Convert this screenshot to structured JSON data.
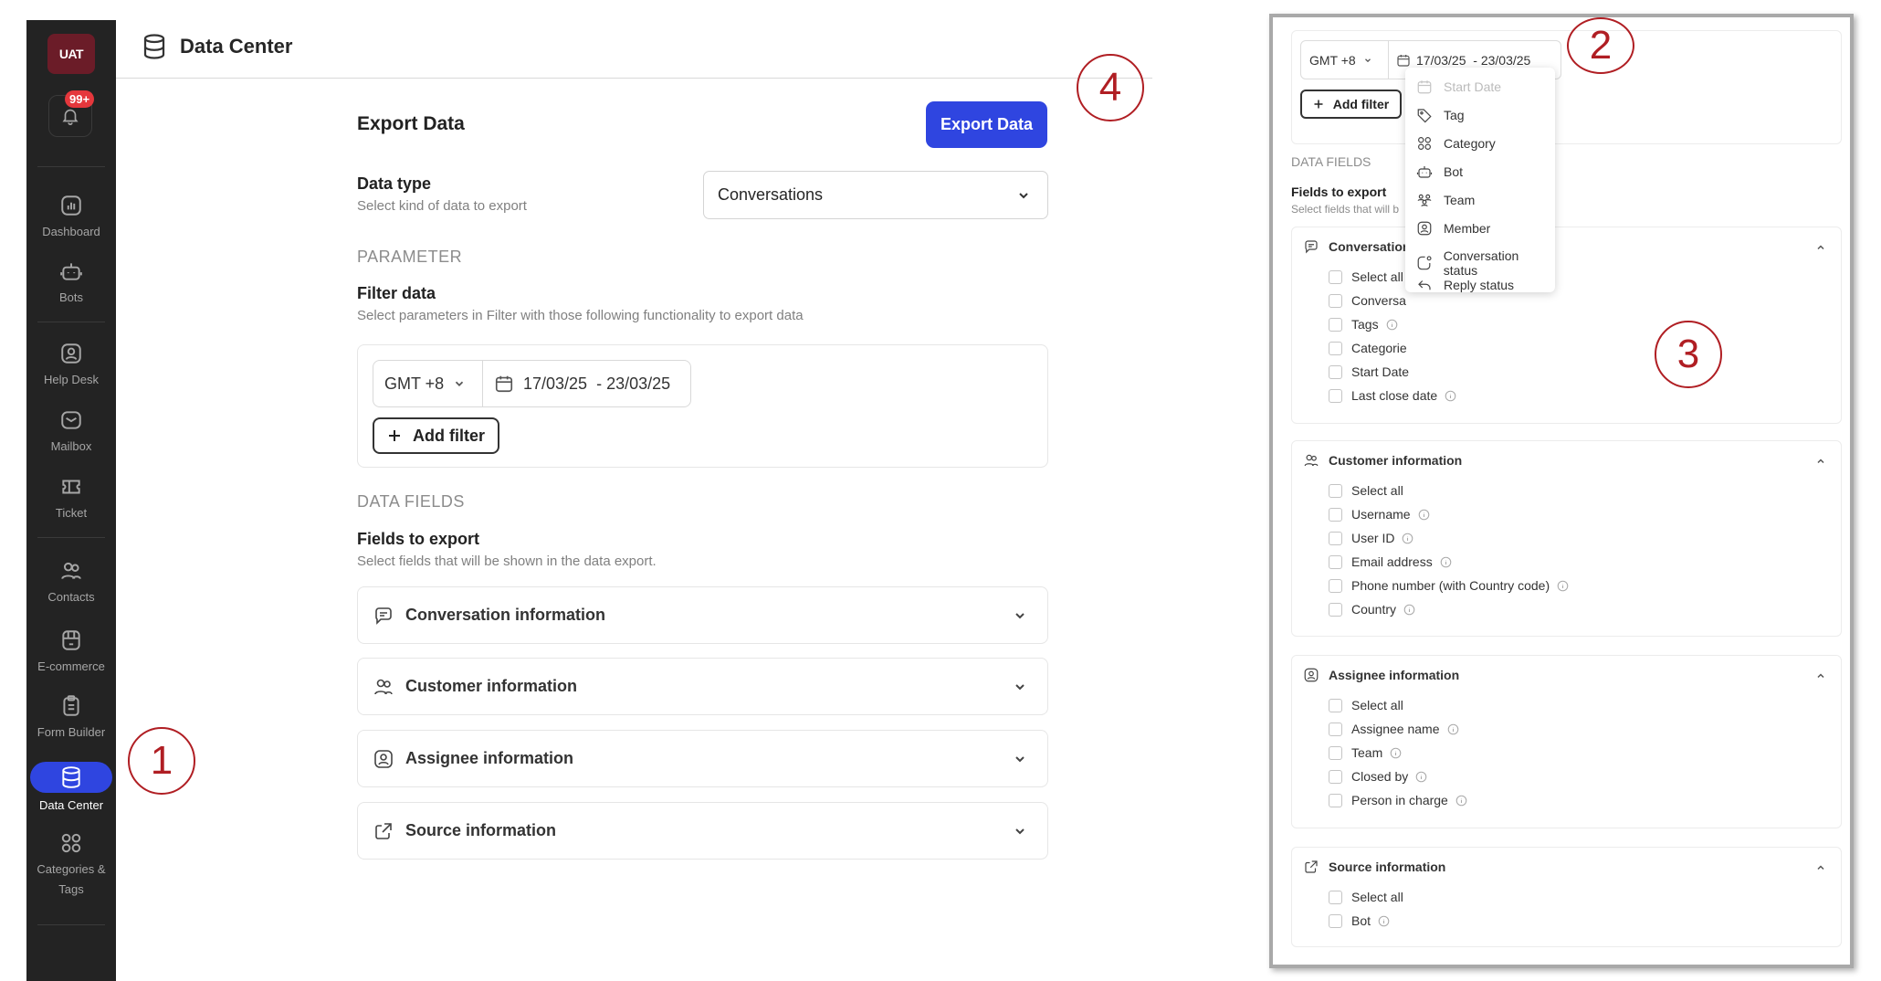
{
  "sidebar": {
    "logo": "UAT",
    "notification_badge": "99+",
    "items": [
      {
        "label": "Dashboard",
        "icon": "dashboard-icon"
      },
      {
        "label": "Bots",
        "icon": "bot-icon"
      },
      {
        "label": "Help Desk",
        "icon": "help-desk-icon"
      },
      {
        "label": "Mailbox",
        "icon": "mailbox-icon"
      },
      {
        "label": "Ticket",
        "icon": "ticket-icon"
      },
      {
        "label": "Contacts",
        "icon": "contacts-icon"
      },
      {
        "label": "E-commerce",
        "icon": "store-icon"
      },
      {
        "label": "Form Builder",
        "icon": "clipboard-icon"
      },
      {
        "label": "Data Center",
        "icon": "database-icon",
        "active": true
      },
      {
        "label": "Categories &",
        "label2": "Tags",
        "icon": "categories-icon"
      }
    ]
  },
  "header": {
    "title": "Data Center",
    "icon": "database-icon"
  },
  "export": {
    "title": "Export Data",
    "export_button": "Export Data",
    "data_type_label": "Data type",
    "data_type_help": "Select kind of data to export",
    "data_type_value": "Conversations",
    "parameter_section": "PARAMETER",
    "filter_label": "Filter data",
    "filter_help": "Select parameters in Filter with those following functionality to export data",
    "timezone": "GMT +8",
    "date_range": "17/03/25  - 23/03/25",
    "add_filter": "Add filter",
    "data_fields_section": "DATA FIELDS",
    "fields_label": "Fields to export",
    "fields_help": "Select fields that will be shown in the data export.",
    "accordions": [
      {
        "label": "Conversation information",
        "icon": "chat-icon"
      },
      {
        "label": "Customer information",
        "icon": "users-icon"
      },
      {
        "label": "Assignee information",
        "icon": "assignee-icon"
      },
      {
        "label": "Source information",
        "icon": "external-link-icon"
      }
    ]
  },
  "annotations": [
    "1",
    "2",
    "3",
    "4"
  ],
  "inset": {
    "timezone": "GMT +8",
    "date_range": "17/03/25  - 23/03/25",
    "add_filter": "Add filter",
    "data_fields_section": "DATA FIELDS",
    "fields_label": "Fields to export",
    "fields_help": "Select fields that will b",
    "filter_menu": [
      {
        "label": "Start Date",
        "icon": "calendar-icon",
        "disabled": true
      },
      {
        "label": "Tag",
        "icon": "tag-icon"
      },
      {
        "label": "Category",
        "icon": "category-icon"
      },
      {
        "label": "Bot",
        "icon": "bot-icon"
      },
      {
        "label": "Team",
        "icon": "team-icon"
      },
      {
        "label": "Member",
        "icon": "member-icon"
      },
      {
        "label": "Conversation status",
        "icon": "status-icon"
      },
      {
        "label": "Reply status",
        "icon": "reply-icon"
      }
    ],
    "groups": [
      {
        "title": "Conversation",
        "icon": "chat-icon",
        "rows": [
          {
            "label": "Select all",
            "info": false
          },
          {
            "label": "Conversa",
            "info": false
          },
          {
            "label": "Tags",
            "info": true
          },
          {
            "label": "Categorie",
            "info": false
          },
          {
            "label": "Start Date",
            "info": false
          },
          {
            "label": "Last close date",
            "info": true
          }
        ]
      },
      {
        "title": "Customer information",
        "icon": "users-icon",
        "rows": [
          {
            "label": "Select all",
            "info": false
          },
          {
            "label": "Username",
            "info": true
          },
          {
            "label": "User ID",
            "info": true
          },
          {
            "label": "Email address",
            "info": true
          },
          {
            "label": "Phone number (with Country code)",
            "info": true
          },
          {
            "label": "Country",
            "info": true
          }
        ]
      },
      {
        "title": "Assignee information",
        "icon": "assignee-icon",
        "rows": [
          {
            "label": "Select all",
            "info": false
          },
          {
            "label": "Assignee name",
            "info": true
          },
          {
            "label": "Team",
            "info": true
          },
          {
            "label": "Closed by",
            "info": true
          },
          {
            "label": "Person in charge",
            "info": true
          }
        ]
      },
      {
        "title": "Source information",
        "icon": "external-link-icon",
        "rows": [
          {
            "label": "Select all",
            "info": false
          },
          {
            "label": "Bot",
            "info": true
          }
        ]
      }
    ]
  },
  "colors": {
    "primary": "#2f45e0",
    "sidebar_bg": "#232323",
    "annotation": "#b01e23",
    "badge": "#e5373c"
  }
}
